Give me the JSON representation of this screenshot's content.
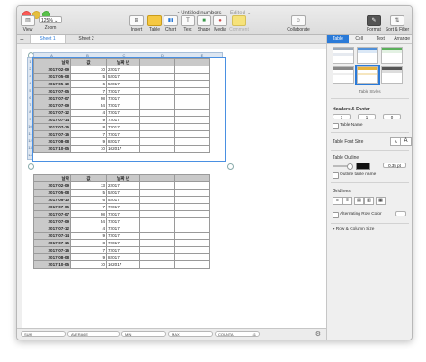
{
  "window": {
    "title": "Untitled.numbers",
    "edited": "— Edited ⌄"
  },
  "toolbar": {
    "view_label": "View",
    "zoom_label": "Zoom",
    "zoom_value": "125% ⌄",
    "insert_label": "Insert",
    "table_label": "Table",
    "chart_label": "Chart",
    "text_label": "Text",
    "shape_label": "Shape",
    "media_label": "Media",
    "comment_label": "Comment",
    "collaborate_label": "Collaborate",
    "format_label": "Format",
    "sort_label": "Sort & Filter"
  },
  "sheets": {
    "add": "+",
    "tabs": [
      "Sheet 1",
      "Sheet 2"
    ]
  },
  "table1": {
    "col_letters": [
      "A",
      "B",
      "C",
      "D",
      "E"
    ],
    "row_numbers": [
      "1",
      "2",
      "3",
      "4",
      "5",
      "6",
      "7",
      "8",
      "9",
      "10",
      "11",
      "12",
      "13",
      "14"
    ],
    "headers": [
      "날짜",
      "값",
      "날짜 년",
      "",
      ""
    ],
    "rows": [
      [
        "2017-02-09",
        "10",
        "22017"
      ],
      [
        "2017-05-08",
        "5",
        "52017"
      ],
      [
        "2017-05-10",
        "6",
        "52017"
      ],
      [
        "2017-07-05",
        "7",
        "72017"
      ],
      [
        "2017-07-07",
        "98",
        "72017"
      ],
      [
        "2017-07-09",
        "54",
        "72017"
      ],
      [
        "2017-07-12",
        "4",
        "72017"
      ],
      [
        "2017-07-14",
        "9",
        "72017"
      ],
      [
        "2017-07-15",
        "8",
        "72017"
      ],
      [
        "2017-07-16",
        "7",
        "72017"
      ],
      [
        "2017-08-08",
        "9",
        "82017"
      ],
      [
        "2017-10-05",
        "10",
        "102017"
      ]
    ]
  },
  "table2": {
    "headers": [
      "날짜",
      "값",
      "날짜 년",
      "",
      ""
    ],
    "rows": [
      [
        "2017-02-09",
        "13",
        "22017"
      ],
      [
        "2017-05-08",
        "5",
        "52017"
      ],
      [
        "2017-05-10",
        "6",
        "52017"
      ],
      [
        "2017-07-05",
        "7",
        "72017"
      ],
      [
        "2017-07-07",
        "98",
        "72017"
      ],
      [
        "2017-07-09",
        "54",
        "72017"
      ],
      [
        "2017-07-12",
        "4",
        "72017"
      ],
      [
        "2017-07-14",
        "9",
        "72017"
      ],
      [
        "2017-07-15",
        "8",
        "72017"
      ],
      [
        "2017-07-16",
        "7",
        "72017"
      ],
      [
        "2017-08-08",
        "9",
        "82017"
      ],
      [
        "2017-10-05",
        "10",
        "102017"
      ]
    ]
  },
  "statusbar": {
    "sum": "SUM",
    "average": "AVERAGE",
    "min": "MIN",
    "max": "MAX",
    "counta": "COUNTA",
    "counta_value": "41"
  },
  "sidebar": {
    "tabs": [
      "Table",
      "Cell",
      "Text",
      "Arrange"
    ],
    "styles_label": "Table Styles",
    "headers_footer": "Headers & Footer",
    "header_rows": "1",
    "header_cols": "1",
    "footer_rows": "0",
    "table_name": "Table Name",
    "table_font_size": "Table Font Size",
    "font_smaller": "A",
    "font_larger": "A",
    "table_outline": "Table Outline",
    "outline_width": "0.35 pt",
    "outline_table_name": "Outline table name",
    "gridlines": "Gridlines",
    "alternating_row_color": "Alternating Row Color",
    "row_column_size": "Row & Column Size"
  },
  "colors": {
    "accent": "#2a7ad8",
    "header_gray": "#c9c9c9"
  }
}
